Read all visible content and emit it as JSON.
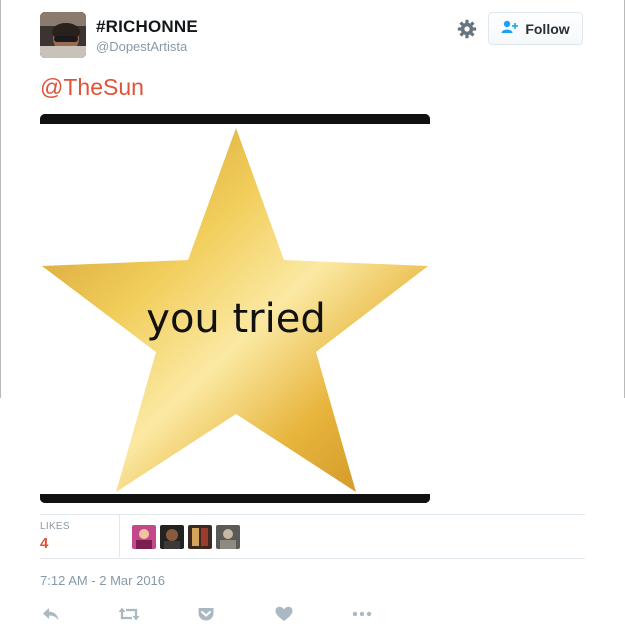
{
  "tweet": {
    "user": {
      "display_name": "#RICHONNE",
      "handle": "@DopestArtista",
      "avatar_icon": "user-avatar"
    },
    "follow_label": "Follow",
    "mention_text": "@TheSun",
    "media": {
      "meme_text": "you tried",
      "star_color": "#e8b83a"
    },
    "likes": {
      "label": "LIKES",
      "count": "4",
      "liker_count": 4
    },
    "timestamp": "7:12 AM - 2 Mar 2016",
    "actions": [
      "reply-icon",
      "retweet-icon",
      "pocket-icon",
      "like-heart-icon",
      "more-icon"
    ]
  },
  "colors": {
    "accent_red": "#e0533a",
    "muted_text": "#8899a6",
    "border": "#e1e8ed"
  }
}
